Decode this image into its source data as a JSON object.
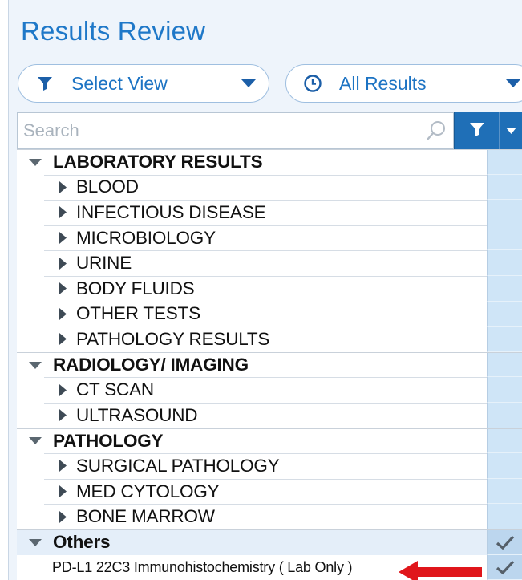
{
  "page": {
    "title": "Results Review"
  },
  "toolbar": {
    "view_label": "Select View",
    "results_label": "All Results"
  },
  "search": {
    "placeholder": "Search"
  },
  "tree": {
    "lab": {
      "label": "LABORATORY RESULTS",
      "children": [
        "BLOOD",
        "INFECTIOUS DISEASE",
        "MICROBIOLOGY",
        "URINE",
        "BODY FLUIDS",
        "OTHER TESTS",
        "PATHOLOGY RESULTS"
      ]
    },
    "radiology": {
      "label": "RADIOLOGY/ IMAGING",
      "children": [
        "CT SCAN",
        "ULTRASOUND"
      ]
    },
    "pathology": {
      "label": "PATHOLOGY",
      "children": [
        "SURGICAL PATHOLOGY",
        "MED CYTOLOGY",
        "BONE MARROW"
      ]
    },
    "others": {
      "label": "Others",
      "item": "PD-L1 22C3 Immunohistochemistry ( Lab Only )"
    }
  },
  "colors": {
    "title_blue": "#1f78c8",
    "button_blue": "#1f6fb7",
    "side_column": "#cfe5f7",
    "arrow_red": "#e0161b"
  },
  "icons": {
    "view": "filter-icon",
    "results": "clock-icon",
    "search": "search-icon",
    "expanded": "caret-down-icon",
    "collapsed": "caret-right-icon",
    "checked": "checkmark-icon",
    "pointer": "red-arrow-icon"
  }
}
